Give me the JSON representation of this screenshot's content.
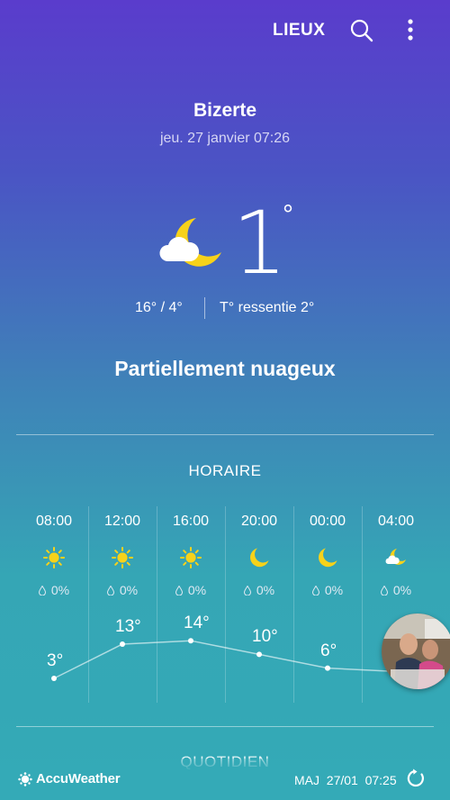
{
  "topbar": {
    "locations_label": "LIEUX",
    "search_icon": "search-icon",
    "more_icon": "more-vert-icon"
  },
  "current": {
    "city": "Bizerte",
    "datetime": "jeu. 27 janvier 07:26",
    "icon": "moon-partly-cloudy-icon",
    "temp": "1",
    "deg": "°",
    "minmax": "16° / 4°",
    "feels": "T° ressentie 2°",
    "condition": "Partiellement nuageux"
  },
  "hourly": {
    "title": "HORAIRE",
    "items": [
      {
        "time": "08:00",
        "icon": "sun-icon",
        "precip": "0%",
        "temp": "3°",
        "temp_value": 3
      },
      {
        "time": "12:00",
        "icon": "sun-icon",
        "precip": "0%",
        "temp": "13°",
        "temp_value": 13
      },
      {
        "time": "16:00",
        "icon": "sun-icon",
        "precip": "0%",
        "temp": "14°",
        "temp_value": 14
      },
      {
        "time": "20:00",
        "icon": "moon-icon",
        "precip": "0%",
        "temp": "10°",
        "temp_value": 10
      },
      {
        "time": "00:00",
        "icon": "moon-icon",
        "precip": "0%",
        "temp": "6°",
        "temp_value": 6
      },
      {
        "time": "04:00",
        "icon": "moon-partly-cloudy-icon",
        "precip": "0%",
        "temp": "",
        "temp_value": 5
      }
    ]
  },
  "daily": {
    "title": "QUOTIDIEN"
  },
  "footer": {
    "brand": "AccuWeather",
    "brand_icon": "accuweather-sun-icon",
    "updated": "MAJ  27/01  07:25",
    "refresh_icon": "refresh-icon"
  },
  "colors": {
    "sun": "#f7d21a",
    "moon": "#f7d21a",
    "bg_top": "#5a3ccc",
    "bg_bottom": "#34aab7"
  }
}
